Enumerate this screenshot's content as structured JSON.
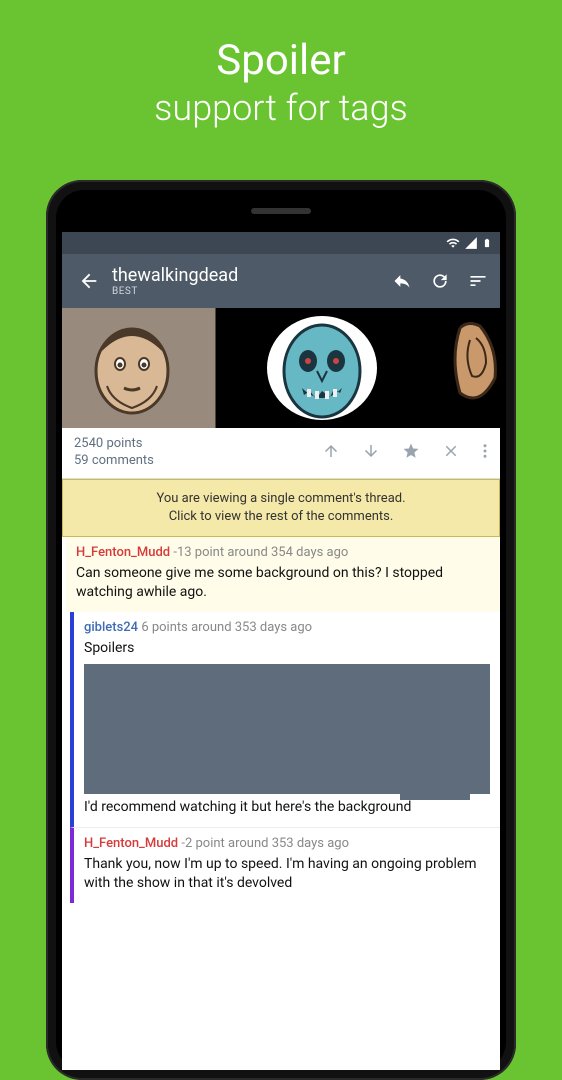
{
  "promo": {
    "line1": "Spoiler",
    "line2": "support for tags"
  },
  "appbar": {
    "title": "thewalkingdead",
    "subtitle": "BEST"
  },
  "post": {
    "points": "2540 points",
    "comments": "59 comments"
  },
  "notice": {
    "line1": "You are viewing a single comment's thread.",
    "line2": "Click to view the rest of the comments."
  },
  "comments": [
    {
      "user": "H_Fenton_Mudd",
      "score": "-13 point around 354 days ago",
      "body": "Can someone give me some background on this? I stopped watching awhile ago."
    },
    {
      "user": "giblets24",
      "score": "6 points around 353 days ago",
      "spoiler_label": "Spoilers",
      "body_after": "I'd recommend watching it but here's the background"
    },
    {
      "user": "H_Fenton_Mudd",
      "score": "-2 point around 353 days ago",
      "body": "Thank you, now I'm up to speed. I'm having an ongoing problem with the show in that it's devolved"
    }
  ]
}
